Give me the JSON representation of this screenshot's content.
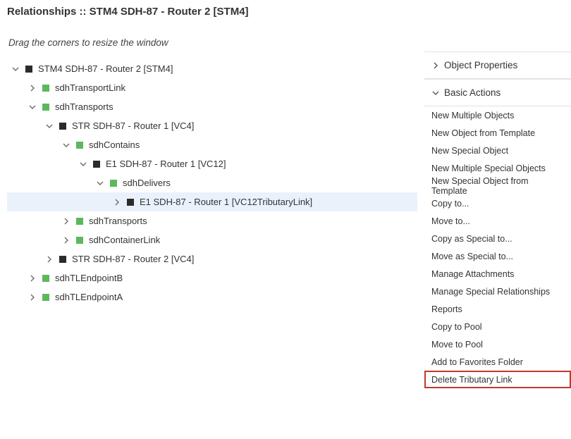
{
  "title": "Relationships :: STM4 SDH-87 - Router 2 [STM4]",
  "hint": "Drag the corners to resize the window",
  "icon_colors": {
    "obj": "black",
    "rel": "green"
  },
  "tree": [
    {
      "depth": 0,
      "expand": "open",
      "color": "obj",
      "label": "STM4 SDH-87 - Router 2 [STM4]",
      "selected": false
    },
    {
      "depth": 1,
      "expand": "closed",
      "color": "rel",
      "label": "sdhTransportLink",
      "selected": false
    },
    {
      "depth": 1,
      "expand": "open",
      "color": "rel",
      "label": "sdhTransports",
      "selected": false
    },
    {
      "depth": 2,
      "expand": "open",
      "color": "obj",
      "label": "STR SDH-87 - Router 1 [VC4]",
      "selected": false
    },
    {
      "depth": 3,
      "expand": "open",
      "color": "rel",
      "label": "sdhContains",
      "selected": false
    },
    {
      "depth": 4,
      "expand": "open",
      "color": "obj",
      "label": "E1 SDH-87 - Router 1 [VC12]",
      "selected": false
    },
    {
      "depth": 5,
      "expand": "open",
      "color": "rel",
      "label": "sdhDelivers",
      "selected": false
    },
    {
      "depth": 6,
      "expand": "closed",
      "color": "obj",
      "label": "E1 SDH-87 - Router 1 [VC12TributaryLink]",
      "selected": true
    },
    {
      "depth": 3,
      "expand": "closed",
      "color": "rel",
      "label": "sdhTransports",
      "selected": false
    },
    {
      "depth": 3,
      "expand": "closed",
      "color": "rel",
      "label": "sdhContainerLink",
      "selected": false
    },
    {
      "depth": 2,
      "expand": "closed",
      "color": "obj",
      "label": "STR SDH-87 - Router 2 [VC4]",
      "selected": false
    },
    {
      "depth": 1,
      "expand": "closed",
      "color": "rel",
      "label": "sdhTLEndpointB",
      "selected": false
    },
    {
      "depth": 1,
      "expand": "closed",
      "color": "rel",
      "label": "sdhTLEndpointA",
      "selected": false
    }
  ],
  "panels": {
    "object_properties": {
      "label": "Object Properties",
      "expanded": false
    },
    "basic_actions": {
      "label": "Basic Actions",
      "expanded": true
    }
  },
  "actions": [
    {
      "label": "New Multiple Objects",
      "highlight": false
    },
    {
      "label": "New Object from Template",
      "highlight": false
    },
    {
      "label": "New Special Object",
      "highlight": false
    },
    {
      "label": "New Multiple Special Objects",
      "highlight": false
    },
    {
      "label": "New Special Object from Template",
      "highlight": false
    },
    {
      "label": "Copy to...",
      "highlight": false
    },
    {
      "label": "Move to...",
      "highlight": false
    },
    {
      "label": "Copy as Special to...",
      "highlight": false
    },
    {
      "label": "Move as Special to...",
      "highlight": false
    },
    {
      "label": "Manage Attachments",
      "highlight": false
    },
    {
      "label": "Manage Special Relationships",
      "highlight": false
    },
    {
      "label": "Reports",
      "highlight": false
    },
    {
      "label": "Copy to Pool",
      "highlight": false
    },
    {
      "label": "Move to Pool",
      "highlight": false
    },
    {
      "label": "Add to Favorites Folder",
      "highlight": false
    },
    {
      "label": "Delete Tributary Link",
      "highlight": true
    }
  ]
}
